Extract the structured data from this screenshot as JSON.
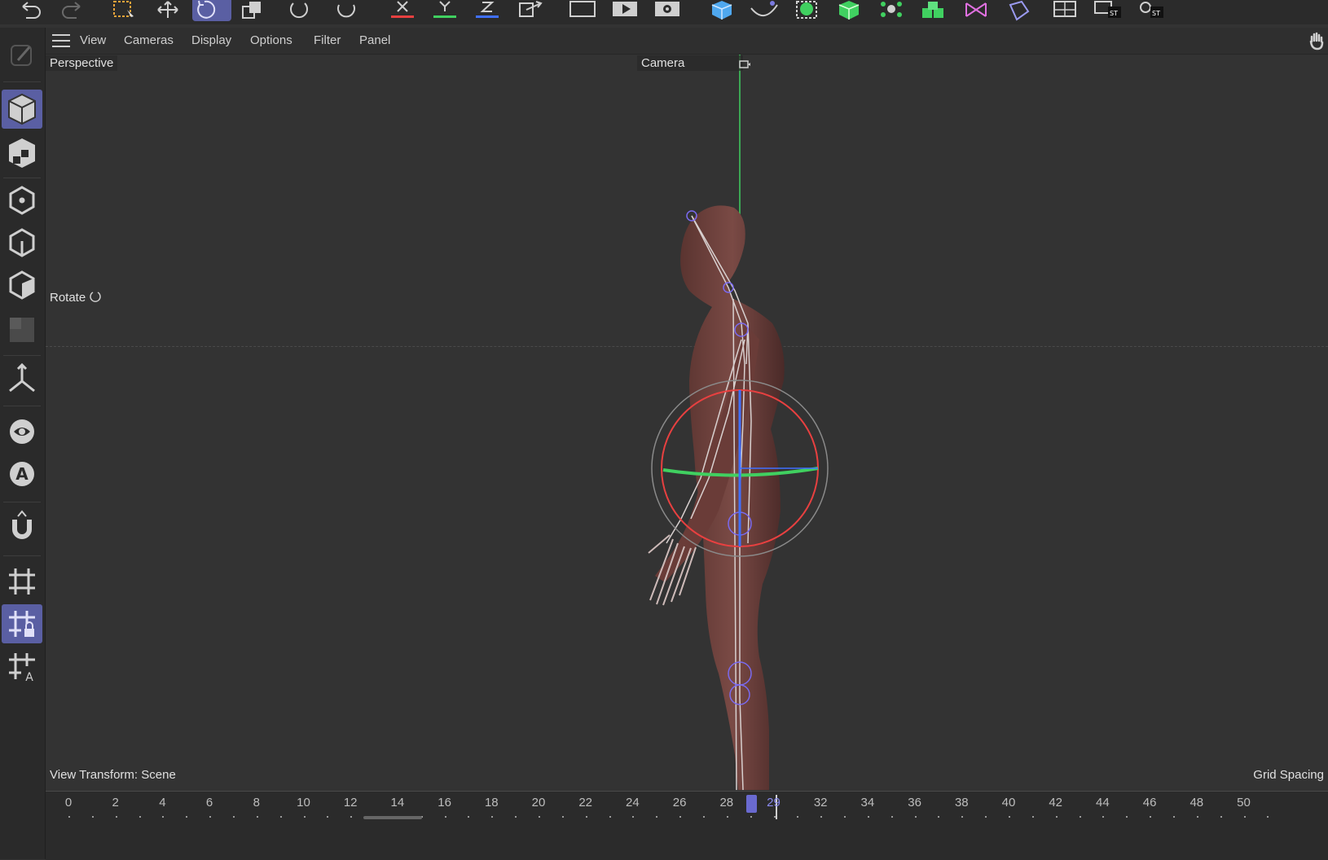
{
  "toolbar": {
    "icons": [
      "undo-icon",
      "redo-icon",
      "live-selection-icon",
      "move-icon",
      "rotate-icon",
      "scale-icon",
      "rotate-ring-icon",
      "rotate-alt-icon",
      "x-axis-icon",
      "y-axis-icon",
      "z-axis-icon",
      "world-coordinate-icon",
      "render-view-icon",
      "render-icon",
      "render-settings-icon",
      "cube-icon",
      "spline-icon",
      "generator-icon",
      "nurbs-icon",
      "mograph-icon",
      "deformer-icon",
      "field-icon",
      "environment-icon",
      "camera-icon",
      "light-icon",
      "floor-icon",
      "scene-icon"
    ]
  },
  "menu": {
    "items": [
      "View",
      "Cameras",
      "Display",
      "Options",
      "Filter",
      "Panel"
    ]
  },
  "viewport": {
    "name": "Perspective",
    "camera": "Camera",
    "tool_label": "Rotate",
    "view_transform": "View Transform: Scene",
    "grid_spacing": "Grid Spacing"
  },
  "left_tools": [
    "edit-icon",
    "model-mode-icon",
    "texture-mode-icon",
    "points-mode-icon",
    "edges-mode-icon",
    "polygons-mode-icon",
    "uv-mode-icon",
    "axis-mode-icon",
    "visibility-icon",
    "solo-icon",
    "snap-icon",
    "workplane-icon",
    "workplane-lock-icon",
    "workplane-align-icon"
  ],
  "timeline": {
    "labels": [
      "0",
      "2",
      "4",
      "6",
      "8",
      "10",
      "12",
      "14",
      "16",
      "18",
      "20",
      "22",
      "24",
      "26",
      "28",
      "29",
      "32",
      "34",
      "36",
      "38",
      "40",
      "42",
      "44",
      "46",
      "48",
      "50"
    ],
    "current_frame": "29"
  },
  "colors": {
    "accent": "#5a5fa3",
    "axis_x": "#e84040",
    "axis_y": "#40d060",
    "axis_z": "#4070ff"
  }
}
